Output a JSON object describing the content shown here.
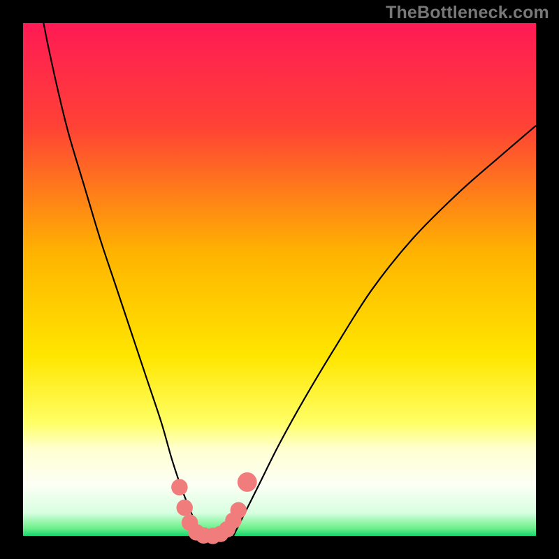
{
  "watermark": "TheBottleneck.com",
  "chart_data": {
    "type": "line",
    "title": "",
    "xlabel": "",
    "ylabel": "",
    "xlim": [
      0,
      100
    ],
    "ylim": [
      0,
      100
    ],
    "gradient_stops": [
      {
        "offset": 0,
        "color": "#ff1a55"
      },
      {
        "offset": 0.2,
        "color": "#ff4136"
      },
      {
        "offset": 0.45,
        "color": "#ffb400"
      },
      {
        "offset": 0.65,
        "color": "#ffe600"
      },
      {
        "offset": 0.78,
        "color": "#ffff66"
      },
      {
        "offset": 0.83,
        "color": "#ffffd0"
      },
      {
        "offset": 0.9,
        "color": "#fcfff5"
      },
      {
        "offset": 0.955,
        "color": "#d8ffe0"
      },
      {
        "offset": 0.985,
        "color": "#6cf08a"
      },
      {
        "offset": 1.0,
        "color": "#17d36e"
      }
    ],
    "series": [
      {
        "name": "left-curve",
        "x": [
          4,
          5,
          7,
          9,
          12,
          15,
          18,
          21,
          24,
          27,
          29,
          31,
          33,
          34.5
        ],
        "y": [
          100,
          95,
          86,
          78,
          68,
          58,
          49,
          40,
          31,
          22,
          15,
          9,
          4,
          0
        ]
      },
      {
        "name": "right-curve",
        "x": [
          41,
          43,
          46,
          50,
          55,
          61,
          68,
          76,
          85,
          93,
          100
        ],
        "y": [
          0,
          4,
          10,
          18,
          27,
          37,
          48,
          58,
          67,
          74,
          80
        ]
      }
    ],
    "markers": {
      "name": "bottom-cluster",
      "color": "#f07c7c",
      "points": [
        {
          "x": 30.5,
          "y": 9.5,
          "r": 1.6
        },
        {
          "x": 31.5,
          "y": 5.5,
          "r": 1.6
        },
        {
          "x": 32.5,
          "y": 2.6,
          "r": 1.6
        },
        {
          "x": 33.8,
          "y": 0.7,
          "r": 1.6
        },
        {
          "x": 35.2,
          "y": 0.1,
          "r": 1.6
        },
        {
          "x": 37.0,
          "y": 0.0,
          "r": 1.6
        },
        {
          "x": 38.5,
          "y": 0.4,
          "r": 1.6
        },
        {
          "x": 39.8,
          "y": 1.3,
          "r": 1.6
        },
        {
          "x": 41.0,
          "y": 3.0,
          "r": 1.6
        },
        {
          "x": 42.0,
          "y": 5.0,
          "r": 1.6
        },
        {
          "x": 43.7,
          "y": 10.5,
          "r": 1.9
        }
      ]
    }
  }
}
